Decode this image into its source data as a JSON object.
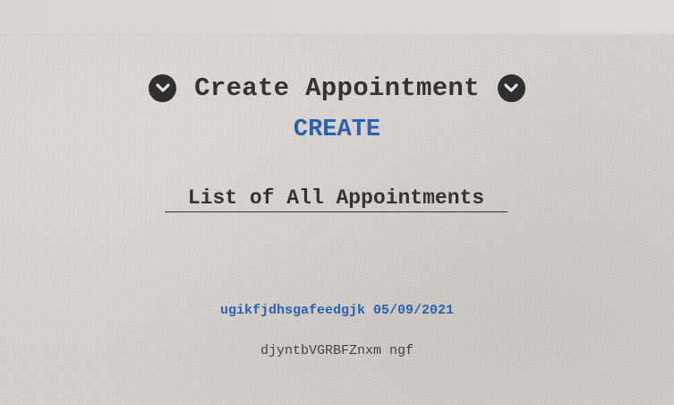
{
  "header": {
    "title": "Create Appointment",
    "left_icon": "chevron-down-icon",
    "right_icon": "chevron-down-icon"
  },
  "create_link": "CREATE",
  "list": {
    "heading": "List of All Appointments",
    "items": [
      {
        "title": "ugikfjdhsgafeedgjk 05/09/2021",
        "description": "djyntbVGRBFZnxm ngf"
      }
    ]
  },
  "colors": {
    "link": "#2a62b0",
    "text": "#333333",
    "background": "#d6d0cb"
  }
}
